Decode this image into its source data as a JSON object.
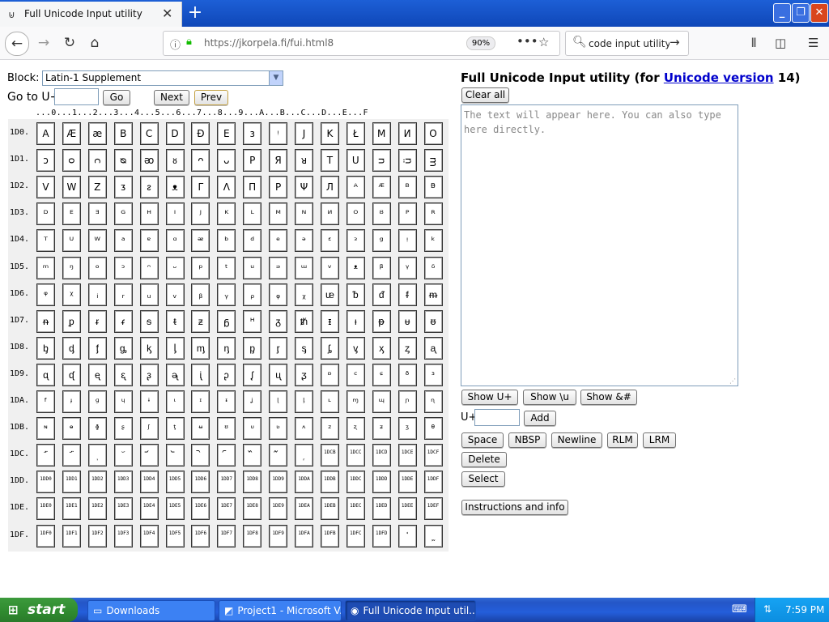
{
  "browser": {
    "tab_title": "Full Unicode Input utility",
    "tab_close": "✕",
    "new_tab": "+",
    "url": "https://jkorpela.fi/fui.html8",
    "zoom": "90%",
    "search_value": "code input utility"
  },
  "page": {
    "block_label": "Block:",
    "block_value": "Latin-1 Supplement",
    "goto_label": "Go to U+",
    "go_button": "Go",
    "next_button": "Next",
    "prev_button": "Prev",
    "hex_header": "...0...1...2...3...4...5...6...7...8...9...A...B...C...D...E...F",
    "rows": [
      {
        "label": "1D0.",
        "cells": [
          "A",
          "Æ",
          "æ",
          "B",
          "C",
          "D",
          "Đ",
          "E",
          "ɜ",
          "ᵎ",
          "J",
          "K",
          "Ł",
          "M",
          "Ͷ",
          "O"
        ]
      },
      {
        "label": "1D1.",
        "cells": [
          "ᴐ",
          "ᴑ",
          "ᴒ",
          "ᴓ",
          "ᴔ",
          "ᴕ",
          "ᴖ",
          "ᴗ",
          "P",
          "Я",
          "ᴚ",
          "T",
          "U",
          "ᴝ",
          "ᴞ",
          "ᴟ"
        ]
      },
      {
        "label": "1D2.",
        "cells": [
          "V",
          "W",
          "Z",
          "ᴣ",
          "ᴤ",
          "ᴥ",
          "Γ",
          "Λ",
          "Π",
          "P",
          "Ψ",
          "Л",
          "ᴬ",
          "ᴭ",
          "ᴮ",
          "ᴯ"
        ]
      },
      {
        "label": "1D3.",
        "cells": [
          "ᴰ",
          "ᴱ",
          "ᴲ",
          "ᴳ",
          "ᴴ",
          "ᴵ",
          "ᴶ",
          "ᴷ",
          "ᴸ",
          "ᴹ",
          "ᴺ",
          "ᴻ",
          "ᴼ",
          "ᴽ",
          "ᴾ",
          "ᴿ"
        ]
      },
      {
        "label": "1D4.",
        "cells": [
          "ᵀ",
          "ᵁ",
          "ᵂ",
          "ᵃ",
          "ᵄ",
          "ᵅ",
          "ᵆ",
          "ᵇ",
          "ᵈ",
          "ᵉ",
          "ᵊ",
          "ᵋ",
          "ᵌ",
          "ᵍ",
          "ᵎ",
          "ᵏ"
        ]
      },
      {
        "label": "1D5.",
        "cells": [
          "ᵐ",
          "ᵑ",
          "ᵒ",
          "ᵓ",
          "ᵔ",
          "ᵕ",
          "ᵖ",
          "ᵗ",
          "ᵘ",
          "ᵙ",
          "ᵚ",
          "ᵛ",
          "ᵜ",
          "ᵝ",
          "ᵞ",
          "ᵟ"
        ]
      },
      {
        "label": "1D6.",
        "cells": [
          "ᵠ",
          "ᵡ",
          "ᵢ",
          "ᵣ",
          "ᵤ",
          "ᵥ",
          "ᵦ",
          "ᵧ",
          "ᵨ",
          "ᵩ",
          "ᵪ",
          "ᵫ",
          "ᵬ",
          "ᵭ",
          "ᵮ",
          "ᵯ"
        ]
      },
      {
        "label": "1D7.",
        "cells": [
          "ᵰ",
          "ᵱ",
          "ᵲ",
          "ᵳ",
          "ᵴ",
          "ᵵ",
          "ᵶ",
          "ᵷ",
          "ᵸ",
          "ᵹ",
          "ᵺ",
          "ᵻ",
          "ᵼ",
          "ᵽ",
          "ᵾ",
          "ᵿ"
        ]
      },
      {
        "label": "1D8.",
        "cells": [
          "ᶀ",
          "ᶁ",
          "ᶂ",
          "ᶃ",
          "ᶄ",
          "ᶅ",
          "ᶆ",
          "ᶇ",
          "ᶈ",
          "ᶉ",
          "ᶊ",
          "ᶋ",
          "ᶌ",
          "ᶍ",
          "ᶎ",
          "ᶏ"
        ]
      },
      {
        "label": "1D9.",
        "cells": [
          "ᶐ",
          "ᶑ",
          "ᶒ",
          "ᶓ",
          "ᶔ",
          "ᶕ",
          "ᶖ",
          "ᶗ",
          "ᶘ",
          "ᶙ",
          "ᶚ",
          "ᶛ",
          "ᶜ",
          "ᶝ",
          "ᶞ",
          "ᶟ"
        ]
      },
      {
        "label": "1DA.",
        "cells": [
          "ᶠ",
          "ᶡ",
          "ᶢ",
          "ᶣ",
          "ᶤ",
          "ᶥ",
          "ᶦ",
          "ᶧ",
          "ᶨ",
          "ᶩ",
          "ᶪ",
          "ᶫ",
          "ᶬ",
          "ᶭ",
          "ᶮ",
          "ᶯ"
        ]
      },
      {
        "label": "1DB.",
        "cells": [
          "ᶰ",
          "ᶱ",
          "ᶲ",
          "ᶳ",
          "ᶴ",
          "ᶵ",
          "ᶶ",
          "ᶷ",
          "ᶸ",
          "ᶹ",
          "ᶺ",
          "ᶻ",
          "ᶼ",
          "ᶽ",
          "ᶾ",
          "ᶿ"
        ]
      },
      {
        "label": "1DC.",
        "cells": [
          "᷀",
          "᷁",
          "᷂",
          "᷃",
          "᷄",
          "᷅",
          "᷆",
          "᷇",
          "᷈",
          "᷉",
          "᷊",
          "1DCB",
          "1DCC",
          "1DCD",
          "1DCE",
          "1DCF"
        ]
      },
      {
        "label": "1DD.",
        "cells": [
          "1DD0",
          "1DD1",
          "1DD2",
          "1DD3",
          "1DD4",
          "1DD5",
          "1DD6",
          "1DD7",
          "1DD8",
          "1DD9",
          "1DDA",
          "1DDB",
          "1DDC",
          "1DDD",
          "1DDE",
          "1DDF"
        ]
      },
      {
        "label": "1DE.",
        "cells": [
          "1DE0",
          "1DE1",
          "1DE2",
          "1DE3",
          "1DE4",
          "1DE5",
          "1DE6",
          "1DE7",
          "1DE8",
          "1DE9",
          "1DEA",
          "1DEB",
          "1DEC",
          "1DED",
          "1DEE",
          "1DEF"
        ]
      },
      {
        "label": "1DF.",
        "cells": [
          "1DF0",
          "1DF1",
          "1DF2",
          "1DF3",
          "1DF4",
          "1DF5",
          "1DF6",
          "1DF7",
          "1DF8",
          "1DF9",
          "1DFA",
          "1DFB",
          "1DFC",
          "1DFD",
          "᷾",
          "᷿"
        ]
      }
    ],
    "title_prefix": "Full Unicode Input utility (for ",
    "title_link": "Unicode version",
    "title_suffix": " 14)",
    "clear_button": "Clear all",
    "textarea_placeholder": "The text will appear here. You can also type here directly.",
    "show_u_button": "Show U+",
    "show_slash_u_button": "Show \\u",
    "show_amp_button": "Show &#",
    "uplus_label": "U+",
    "add_button": "Add",
    "space_button": "Space",
    "nbsp_button": "NBSP",
    "newline_button": "Newline",
    "rlm_button": "RLM",
    "lrm_button": "LRM",
    "delete_button": "Delete",
    "select_button": "Select",
    "instructions_button": "Instructions and info"
  },
  "taskbar": {
    "start_label": "start",
    "tasks": [
      "Downloads",
      "Project1 - Microsoft V...",
      "Full Unicode Input util..."
    ],
    "clock": "7:59 PM"
  },
  "colors": {
    "link": "#0000cc",
    "taskbar": "#245edb",
    "start": "#2f8a2f"
  }
}
